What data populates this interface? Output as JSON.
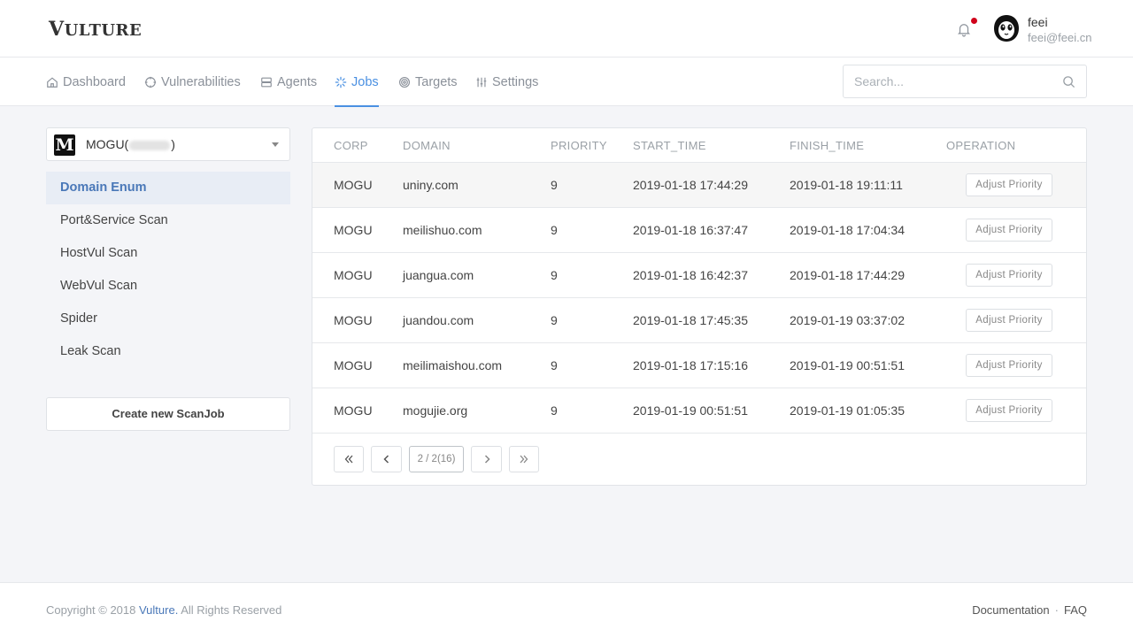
{
  "app": {
    "logo": "Vulture"
  },
  "header": {
    "user": {
      "name": "feei",
      "email": "feei@feei.cn"
    }
  },
  "nav": {
    "items": [
      {
        "label": "Dashboard",
        "icon": "home-icon"
      },
      {
        "label": "Vulnerabilities",
        "icon": "crosshair-icon"
      },
      {
        "label": "Agents",
        "icon": "server-icon"
      },
      {
        "label": "Jobs",
        "icon": "spinner-icon",
        "active": true
      },
      {
        "label": "Targets",
        "icon": "target-icon"
      },
      {
        "label": "Settings",
        "icon": "sliders-icon"
      }
    ],
    "search_placeholder": "Search..."
  },
  "sidebar": {
    "corp": {
      "logo_letter": "M",
      "name_prefix": "MOGU(",
      "name_suffix": ")"
    },
    "items": [
      {
        "label": "Domain Enum",
        "active": true
      },
      {
        "label": "Port&Service Scan"
      },
      {
        "label": "HostVul Scan"
      },
      {
        "label": "WebVul Scan"
      },
      {
        "label": "Spider"
      },
      {
        "label": "Leak Scan"
      }
    ],
    "create_button": "Create new ScanJob"
  },
  "table": {
    "columns": [
      "CORP",
      "DOMAIN",
      "PRIORITY",
      "START_TIME",
      "FINISH_TIME",
      "OPERATION"
    ],
    "action_label": "Adjust Priority",
    "rows": [
      {
        "corp": "MOGU",
        "domain": "uniny.com",
        "priority": "9",
        "start": "2019-01-18 17:44:29",
        "finish": "2019-01-18 19:11:11"
      },
      {
        "corp": "MOGU",
        "domain": "meilishuo.com",
        "priority": "9",
        "start": "2019-01-18 16:37:47",
        "finish": "2019-01-18 17:04:34"
      },
      {
        "corp": "MOGU",
        "domain": "juangua.com",
        "priority": "9",
        "start": "2019-01-18 16:42:37",
        "finish": "2019-01-18 17:44:29"
      },
      {
        "corp": "MOGU",
        "domain": "juandou.com",
        "priority": "9",
        "start": "2019-01-18 17:45:35",
        "finish": "2019-01-19 03:37:02"
      },
      {
        "corp": "MOGU",
        "domain": "meilimaishou.com",
        "priority": "9",
        "start": "2019-01-18 17:15:16",
        "finish": "2019-01-19 00:51:51"
      },
      {
        "corp": "MOGU",
        "domain": "mogujie.org",
        "priority": "9",
        "start": "2019-01-19 00:51:51",
        "finish": "2019-01-19 01:05:35"
      }
    ],
    "pagination": {
      "indicator": "2 / 2(16)"
    }
  },
  "footer": {
    "copyright_prefix": "Copyright © 2018 ",
    "brand": "Vulture.",
    "copyright_suffix": " All Rights Reserved",
    "links": [
      "Documentation",
      "FAQ"
    ],
    "separator": "·"
  },
  "colors": {
    "accent": "#4a90e2",
    "notification": "#d0021b"
  }
}
